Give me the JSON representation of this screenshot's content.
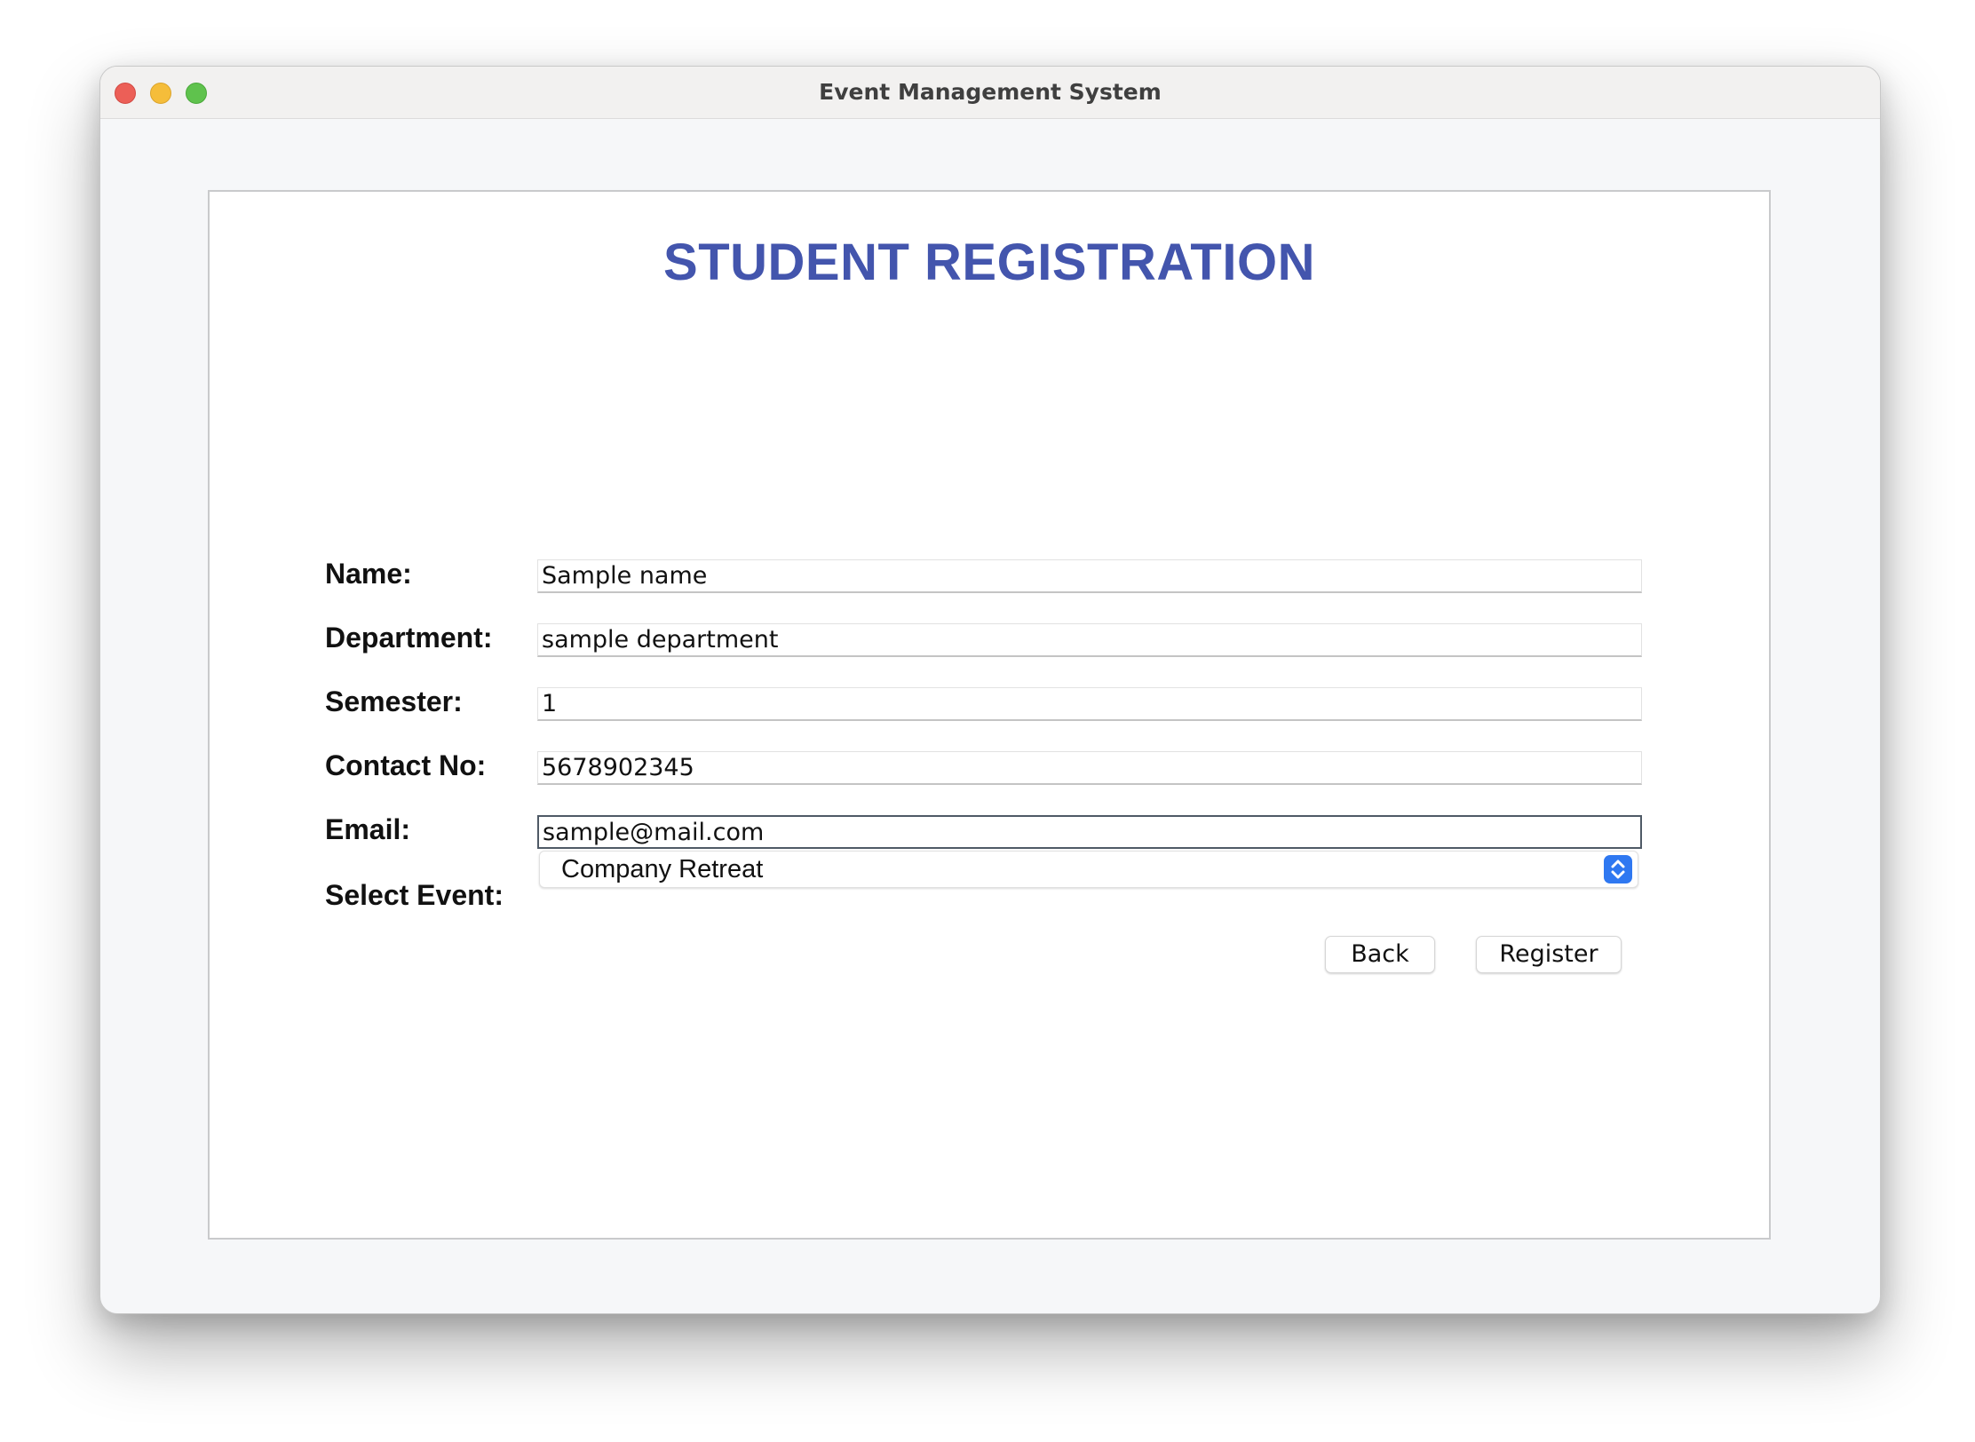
{
  "window": {
    "title": "Event Management System"
  },
  "form": {
    "title": "STUDENT REGISTRATION",
    "fields": [
      {
        "label": "Name:",
        "value": "Sample name"
      },
      {
        "label": "Department:",
        "value": "sample department"
      },
      {
        "label": "Semester:",
        "value": "1"
      },
      {
        "label": "Contact No:",
        "value": "5678902345"
      },
      {
        "label": "Email:",
        "value": "sample@mail.com"
      }
    ],
    "event": {
      "label": "Select Event:",
      "selected": "Company Retreat"
    },
    "buttons": {
      "back": "Back",
      "register": "Register"
    }
  },
  "colors": {
    "title": "#4355ad",
    "select_accent": "#2f78f1",
    "close": "#ec5f57",
    "minimize": "#f5bd3a",
    "maximize": "#5fc24d"
  },
  "icons": {
    "window_controls": [
      "close-icon",
      "minimize-icon",
      "maximize-icon"
    ],
    "select": "up-down-chevron-icon"
  }
}
